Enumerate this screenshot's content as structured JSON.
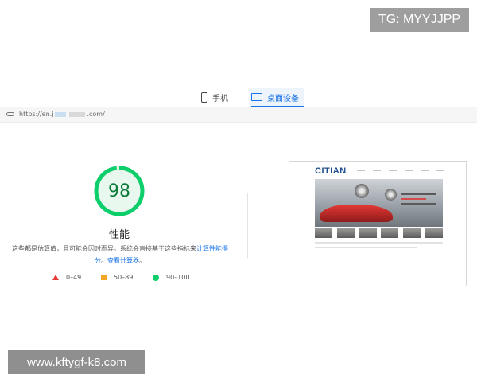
{
  "watermark_top": "TG: MYYJJPP",
  "tabs": {
    "mobile": "手机",
    "desktop": "桌面设备"
  },
  "url": {
    "prefix": "https://en.j",
    "suffix": ".com/"
  },
  "performance": {
    "score": "98",
    "score_value": 98,
    "score_max": 100,
    "title": "性能",
    "desc_main": "这些都是估算值，且可能会因时而异。系统会直接基于这些指标来",
    "desc_link1": "计算性能得分",
    "desc_sep": "。",
    "desc_link2": "查看计算器",
    "desc_end": "。"
  },
  "legend": [
    {
      "range": "0–49",
      "color": "#e53935"
    },
    {
      "range": "50–89",
      "color": "#f5a623"
    },
    {
      "range": "90–100",
      "color": "#0cce6b"
    }
  ],
  "thumbnail": {
    "logo": "CITIAN"
  },
  "watermark_bottom": "www.kftygf-k8.com",
  "colors": {
    "accent": "#1a73e8",
    "good": "#0cce6b",
    "good_text": "#0b7a3a"
  }
}
